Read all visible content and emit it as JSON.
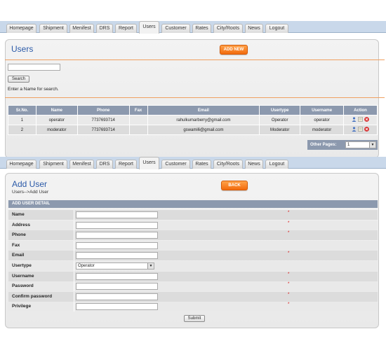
{
  "nav": {
    "tabs": [
      "Homepage",
      "Shipment",
      "Menifest",
      "DRS",
      "Report",
      "Users",
      "Customer",
      "Rates",
      "City/Roots",
      "News",
      "Logout"
    ],
    "active": "Users"
  },
  "users_page": {
    "title": "Users",
    "add_new_label": "ADD NEW",
    "search_value": "",
    "search_button": "Search",
    "search_hint": "Enter a Name for search.",
    "columns": [
      "Sr.No.",
      "Name",
      "Phone",
      "Fax",
      "Email",
      "Usertype",
      "Username",
      "Action"
    ],
    "rows": [
      {
        "srno": "1",
        "name": "operator",
        "phone": "7737693714",
        "fax": "",
        "email": "rahulkumarberry@gmail.com",
        "usertype": "Operator",
        "username": "operator"
      },
      {
        "srno": "2",
        "name": "moderator",
        "phone": "7737693714",
        "fax": "",
        "email": "gswami6@gmail.com",
        "usertype": "Moderator",
        "username": "moderator"
      }
    ],
    "action_icons": [
      "user-icon",
      "edit-icon",
      "delete-icon"
    ],
    "pager_label": "Other Pages:",
    "pager_value": "1"
  },
  "add_user_page": {
    "title": "Add User",
    "breadcrumb": "Users-->Add User",
    "back_label": "BACK",
    "section_header": "ADD USER DETAIL",
    "fields": [
      {
        "label": "Name",
        "value": "",
        "required": true
      },
      {
        "label": "Address",
        "value": "",
        "required": true
      },
      {
        "label": "Phone",
        "value": "",
        "required": true
      },
      {
        "label": "Fax",
        "value": "",
        "required": false
      },
      {
        "label": "Email",
        "value": "",
        "required": true
      },
      {
        "label": "Usertype",
        "value": "Operator",
        "required": false
      },
      {
        "label": "Username",
        "value": "",
        "required": true
      },
      {
        "label": "Password",
        "value": "",
        "required": true
      },
      {
        "label": "Confirm password",
        "value": "",
        "required": true
      },
      {
        "label": "Privilege",
        "value": "",
        "required": true
      }
    ],
    "required_mark": "*",
    "submit_label": "Submit"
  },
  "colors": {
    "accent_orange": "#f26b0d",
    "header_blue_gray": "#8c99ae",
    "title_blue": "#2b5aa8",
    "delete_red": "#d61c1c"
  }
}
